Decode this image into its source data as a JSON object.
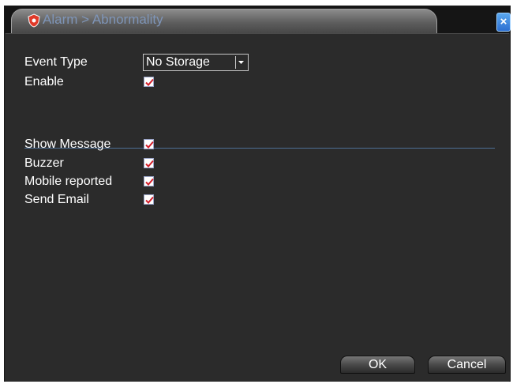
{
  "window": {
    "title": "Alarm > Abnormality",
    "close_label": "×"
  },
  "form": {
    "event_type_label": "Event Type",
    "event_type_value": "No Storage",
    "enable_label": "Enable",
    "show_message_label": "Show Message",
    "buzzer_label": "Buzzer",
    "mobile_reported_label": "Mobile reported",
    "send_email_label": "Send Email"
  },
  "checkboxes": {
    "enable": true,
    "show_message": true,
    "buzzer": true,
    "mobile_reported": true,
    "send_email": true
  },
  "buttons": {
    "ok_label": "OK",
    "cancel_label": "Cancel"
  },
  "colors": {
    "background": "#2b2b2b",
    "title_text": "#7e95b8",
    "divider": "#4e6f96",
    "check_mark": "#d21e2a"
  }
}
